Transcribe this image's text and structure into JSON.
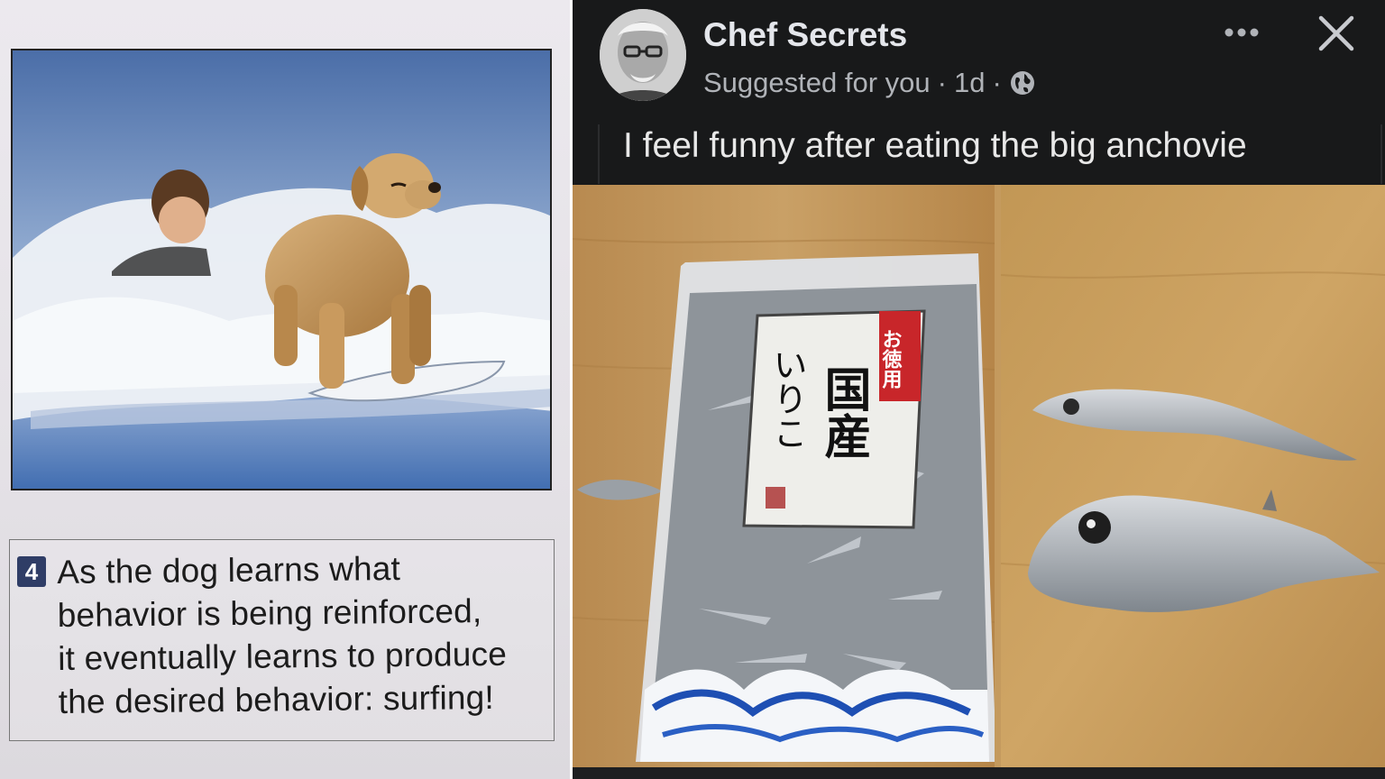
{
  "left_panel": {
    "caption_number": "4",
    "caption_lines": [
      "As the dog learns what",
      "behavior is being reinforced,",
      "it eventually learns to produce",
      "the desired behavior: surfing!"
    ]
  },
  "post": {
    "page_name": "Chef Secrets",
    "meta_suggested": "Suggested for you",
    "meta_separator": "·",
    "meta_time": "1d",
    "text": "I feel funny after eating the big anchovie",
    "package_label_vertical_1": "いりこ",
    "package_label_vertical_2": "国産",
    "package_badge": "お徳用",
    "icons": [
      "globe-icon",
      "more-options-icon",
      "close-icon"
    ]
  },
  "colors": {
    "post_bg": "#18191a",
    "post_name": "#e4e6eb",
    "post_meta": "#b0b3b8",
    "caption_badge": "#2f3d66",
    "wood": "#c49a5e"
  }
}
